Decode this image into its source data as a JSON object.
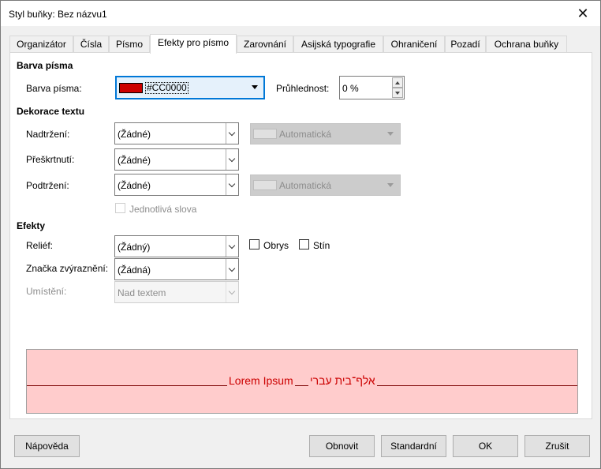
{
  "window": {
    "title": "Styl buňky: Bez názvu1",
    "close_glyph": "✕"
  },
  "tabs": [
    {
      "label": "Organizátor"
    },
    {
      "label": "Čísla"
    },
    {
      "label": "Písmo"
    },
    {
      "label": "Efekty pro písmo",
      "active": true
    },
    {
      "label": "Zarovnání"
    },
    {
      "label": "Asijská typografie"
    },
    {
      "label": "Ohraničení"
    },
    {
      "label": "Pozadí"
    },
    {
      "label": "Ochrana buňky"
    }
  ],
  "font_color": {
    "section": "Barva písma",
    "label": "Barva písma:",
    "value": "#CC0000",
    "swatch_color": "#CC0000",
    "transparency_label": "Průhlednost:",
    "transparency_value": "0 %"
  },
  "decoration": {
    "section": "Dekorace textu",
    "overline_label": "Nadtržení:",
    "overline_value": "(Žádné)",
    "overline_color": "Automatická",
    "strikethrough_label": "Přeškrtnutí:",
    "strikethrough_value": "(Žádné)",
    "underline_label": "Podtržení:",
    "underline_value": "(Žádné)",
    "underline_color": "Automatická",
    "individual_words_label": "Jednotlivá slova"
  },
  "effects": {
    "section": "Efekty",
    "relief_label": "Reliéf:",
    "relief_value": "(Žádný)",
    "outline_label": "Obrys",
    "shadow_label": "Stín",
    "emphasis_label": "Značka zvýraznění:",
    "emphasis_value": "(Žádná)",
    "position_label": "Umístění:",
    "position_value": "Nad textem"
  },
  "preview": {
    "latin_text": "Lorem Ipsum",
    "hebrew_text": "אלף־בית עברי",
    "text_color": "#CC0000",
    "background": "#FFCCCC"
  },
  "buttons": {
    "help": "Nápověda",
    "reset": "Obnovit",
    "standard": "Standardní",
    "ok": "OK",
    "cancel": "Zrušit"
  }
}
